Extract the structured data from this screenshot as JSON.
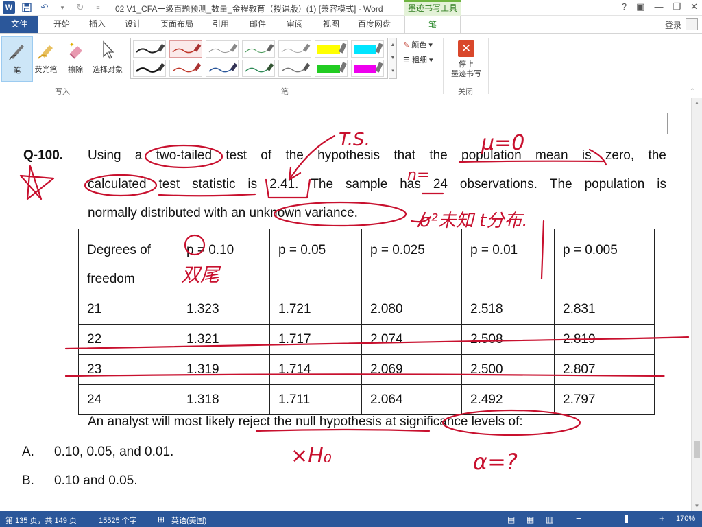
{
  "titlebar": {
    "title": "02 V1_CFA一级百题预测_数量_金程教育（授课版）(1) [兼容模式] - Word",
    "context_tab_title": "墨迹书写工具",
    "help": "?",
    "word_logo": "W"
  },
  "tabs": [
    {
      "label": "文件"
    },
    {
      "label": "开始"
    },
    {
      "label": "插入"
    },
    {
      "label": "设计"
    },
    {
      "label": "页面布局"
    },
    {
      "label": "引用"
    },
    {
      "label": "邮件"
    },
    {
      "label": "审阅"
    },
    {
      "label": "视图"
    },
    {
      "label": "百度网盘"
    },
    {
      "label": "笔"
    }
  ],
  "login": "登录",
  "ribbon": {
    "write_group": {
      "label": "写入",
      "tools": [
        {
          "label": "笔",
          "icon": "pen-icon"
        },
        {
          "label": "荧光笔",
          "icon": "highlighter-icon"
        },
        {
          "label": "擦除",
          "icon": "eraser-icon"
        },
        {
          "label": "选择对象",
          "icon": "cursor-icon"
        }
      ]
    },
    "pens_group": {
      "label": "笔",
      "color_label": "颜色",
      "weight_label": "粗细",
      "pens_top": [
        {
          "color": "#222222"
        },
        {
          "color": "#c0392b"
        },
        {
          "color": "#888888"
        },
        {
          "color": "#4a9a5a"
        },
        {
          "color": "#888888"
        },
        {
          "color": "#ffff00"
        },
        {
          "color": "#00e5ff"
        }
      ],
      "pens_bottom": [
        {
          "color": "#111111"
        },
        {
          "color": "#c0392b"
        },
        {
          "color": "#2b579a"
        },
        {
          "color": "#2e8b57"
        },
        {
          "color": "#777777"
        },
        {
          "color": "#22cc22"
        },
        {
          "color": "#ee00ee"
        }
      ]
    },
    "close_group": {
      "label": "关闭",
      "stop_label_line1": "停止",
      "stop_label_line2": "墨迹书写"
    }
  },
  "document": {
    "question_number": "Q-100.",
    "line1_words": [
      "Using",
      "a",
      "two-tailed",
      "test",
      "of",
      "the",
      "hypothesis",
      "that",
      "the",
      "population",
      "mean",
      "is",
      "zero,",
      "the"
    ],
    "line2_words": [
      "calculated",
      "test",
      "statistic",
      "is",
      "2.41.",
      "The",
      "sample",
      "has",
      "24",
      "observations.",
      "The",
      "population",
      "is"
    ],
    "line3": "normally distributed with an unknown variance.",
    "table": {
      "header_col1_line1": "Degrees of",
      "header_col1_line2": "freedom",
      "headers": [
        "p = 0.10",
        "p = 0.05",
        "p = 0.025",
        "p = 0.01",
        "p = 0.005"
      ],
      "rows": [
        [
          "21",
          "1.323",
          "1.721",
          "2.080",
          "2.518",
          "2.831"
        ],
        [
          "22",
          "1.321",
          "1.717",
          "2.074",
          "2.508",
          "2.819"
        ],
        [
          "23",
          "1.319",
          "1.714",
          "2.069",
          "2.500",
          "2.807"
        ],
        [
          "24",
          "1.318",
          "1.711",
          "2.064",
          "2.492",
          "2.797"
        ]
      ]
    },
    "follow_up": "An analyst will most likely reject the null hypothesis at significance levels of:",
    "options": [
      {
        "letter": "A.",
        "text": "0.10, 0.05, and 0.01."
      },
      {
        "letter": "B.",
        "text": "0.10 and 0.05."
      }
    ],
    "ink_annotations": {
      "ts": "T.S.",
      "mu_zero": "μ=0",
      "n_eq": "n=",
      "sigma_unknown": "σ²未知  t分布.",
      "double_tail": "双尾",
      "reject_h0": "×H₀",
      "alpha_q": "α=?",
      "ink_color": "#c8102e"
    }
  },
  "statusbar": {
    "page": "第 135 页，共 149 页",
    "words": "15525 个字",
    "language": "英语(美国)",
    "zoom": "170%"
  },
  "colors": {
    "word_blue": "#2b579a",
    "ink_red": "#c8102e",
    "pen_tab_green": "#2e8b2e"
  }
}
